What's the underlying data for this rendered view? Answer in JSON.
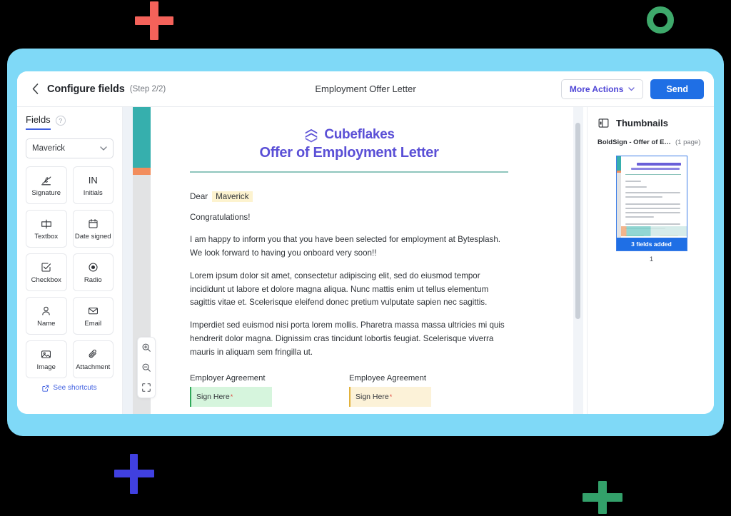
{
  "header": {
    "back_icon": "chevron-left-icon",
    "title": "Configure fields",
    "step": "(Step 2/2)",
    "document_title": "Employment Offer Letter",
    "more_actions_label": "More Actions",
    "more_actions_icon": "chevron-down-icon",
    "send_label": "Send"
  },
  "sidebar": {
    "tab_label": "Fields",
    "help_icon": "question-mark-icon",
    "help_glyph": "?",
    "recipient": {
      "value": "Maverick",
      "chevron_icon": "chevron-down-icon",
      "chevron_glyph": "∨"
    },
    "fields": [
      {
        "label": "Signature",
        "icon": "signature-pen-icon"
      },
      {
        "label": "Initials",
        "icon": "initials-icon",
        "glyph": "IN"
      },
      {
        "label": "Textbox",
        "icon": "textbox-icon"
      },
      {
        "label": "Date signed",
        "icon": "calendar-icon"
      },
      {
        "label": "Checkbox",
        "icon": "checkbox-icon"
      },
      {
        "label": "Radio",
        "icon": "radio-button-icon"
      },
      {
        "label": "Name",
        "icon": "person-icon"
      },
      {
        "label": "Email",
        "icon": "envelope-icon"
      },
      {
        "label": "Image",
        "icon": "image-icon"
      },
      {
        "label": "Attachment",
        "icon": "paperclip-icon"
      }
    ],
    "see_shortcuts_label": "See shortcuts",
    "see_shortcuts_icon": "external-link-icon"
  },
  "document": {
    "brand_name": "Cubeflakes",
    "brand_icon": "cubeflakes-logo-icon",
    "letter_title": "Offer of Employment Letter",
    "salutation": "Dear",
    "recipient_field_value": "Maverick",
    "paragraphs": [
      "Congratulations!",
      "I am happy to inform you that you have been selected for employment at Bytesplash. We look forward to having you onboard very soon!!",
      "Lorem ipsum dolor sit amet, consectetur adipiscing elit, sed do eiusmod tempor incididunt ut labore et dolore magna aliqua. Nunc mattis enim ut tellus elementum sagittis vitae et. Scelerisque eleifend donec pretium vulputate sapien nec sagittis.",
      "Imperdiet sed euismod nisi porta lorem mollis. Pharetra massa massa ultricies mi quis hendrerit dolor magna. Dignissim cras tincidunt lobortis feugiat. Scelerisque viverra mauris in aliquam sem fringilla ut."
    ],
    "agreements": [
      {
        "label": "Employer Agreement",
        "field_text": "Sign Here",
        "required_marker": "*"
      },
      {
        "label": "Employee Agreement",
        "field_text": "Sign Here",
        "required_marker": "*"
      }
    ]
  },
  "zoom_controls": [
    {
      "name": "zoom-in-icon"
    },
    {
      "name": "zoom-out-icon"
    },
    {
      "name": "fit-to-screen-icon"
    }
  ],
  "thumbnails": {
    "panel_icon": "panel-layout-icon",
    "title": "Thumbnails",
    "document_name": "BoldSign - Offer of Emplo...",
    "page_count": "(1 page)",
    "fields_badge": "3 fields added",
    "page_number": "1"
  },
  "colors": {
    "accent_blue": "#1f6fe5",
    "brand_purple": "#5a4fd6",
    "frame_blue": "#7fd9f7",
    "teal": "#36afad",
    "orange": "#f28d5c",
    "green_field": "#d6f5dd",
    "yellow_field": "#fcf2d8",
    "deco_red": "#f4625a",
    "deco_green": "#33a06a",
    "deco_blue": "#4040e0"
  }
}
